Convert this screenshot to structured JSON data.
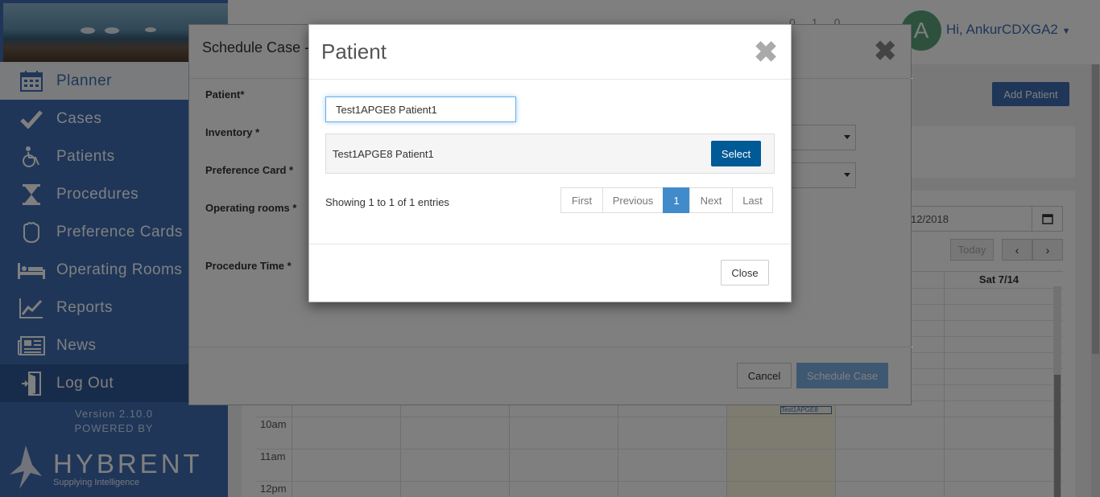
{
  "sidebar": {
    "items": [
      {
        "label": "Planner",
        "icon": "calendar-icon"
      },
      {
        "label": "Cases",
        "icon": "check-icon"
      },
      {
        "label": "Patients",
        "icon": "wheelchair-icon"
      },
      {
        "label": "Procedures",
        "icon": "hourglass-icon"
      },
      {
        "label": "Preference Cards",
        "icon": "glove-icon"
      },
      {
        "label": "Operating Rooms",
        "icon": "bed-icon"
      },
      {
        "label": "Reports",
        "icon": "chart-icon"
      },
      {
        "label": "News",
        "icon": "newspaper-icon"
      },
      {
        "label": "Log Out",
        "icon": "door-icon"
      }
    ],
    "version": "Version 2.10.0",
    "powered_by": "POWERED BY",
    "brand": "HYBRENT",
    "brand_tagline": "Supplying Intelligence"
  },
  "topbar": {
    "counters": [
      "0",
      "1",
      "0"
    ],
    "avatar_letter": "A",
    "greeting": "Hi, AnkurCDXGA2"
  },
  "main": {
    "add_patient_label": "Add Patient",
    "date_value": "12/2018",
    "today_label": "Today",
    "prev_label": "‹",
    "next_label": "›",
    "day_header": "Sat 7/14",
    "times": [
      "10am",
      "11am",
      "12pm"
    ],
    "event_text": "Test1APGE8"
  },
  "schedule_modal": {
    "title": "Schedule Case - J",
    "labels": {
      "patient": "Patient*",
      "inventory": "Inventory *",
      "preference_card": "Preference Card *",
      "operating_rooms": "Operating rooms *",
      "procedure_time": "Procedure Time *"
    },
    "cancel_label": "Cancel",
    "submit_label": "Schedule Case"
  },
  "patient_modal": {
    "title": "Patient",
    "search_value": "Test1APGE8 Patient1",
    "results": [
      {
        "name": "Test1APGE8 Patient1",
        "action": "Select"
      }
    ],
    "info": "Showing 1 to 1 of 1 entries",
    "pager": [
      "First",
      "Previous",
      "1",
      "Next",
      "Last"
    ],
    "active_page": "1",
    "close_label": "Close"
  },
  "colors": {
    "sidebar": "#3e6db2",
    "primary_button": "#005a96",
    "pager_active": "#428bca",
    "avatar": "#5aa37a"
  }
}
